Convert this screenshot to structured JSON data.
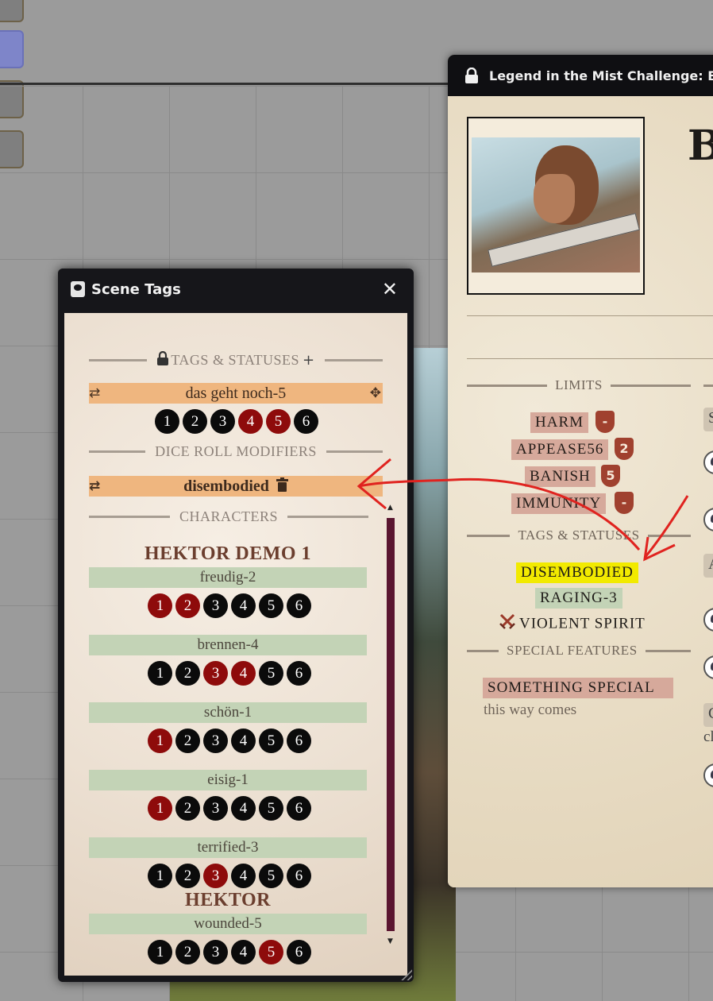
{
  "challenge_window": {
    "title": "Legend in the Mist Challenge: BAC",
    "name_visible": "B",
    "limits_heading": "LIMITS",
    "limits": [
      {
        "label": "HARM",
        "badge": "-"
      },
      {
        "label": "APPEASE56",
        "badge": "2"
      },
      {
        "label": "BANISH",
        "badge": "5"
      },
      {
        "label": "IMMUNITY",
        "badge": "-"
      }
    ],
    "tags_heading": "TAGS & STATUSES",
    "tags": [
      {
        "label": "DISEMBODIED",
        "color": "#f2ea00"
      },
      {
        "label": "RAGING-3",
        "color": "#c3d3b6"
      },
      {
        "label": "VIOLENT SPIRIT",
        "icon": "crossed-swords-icon"
      }
    ],
    "special_heading": "SPECIAL FEATURES",
    "special": {
      "label": "SOMETHING SPECIAL",
      "description": "this way comes"
    },
    "right_column_initials": [
      "S",
      "A",
      "C"
    ],
    "right_column_text": "cl"
  },
  "scene_tags": {
    "title": "Scene Tags",
    "close_label": "✕",
    "tags_heading": "TAGS & STATUSES",
    "tags_lock_icon": "lock-icon",
    "tags_add_icon": "plus-icon",
    "scene_tag": {
      "label": "das geht noch-5",
      "dice": [
        {
          "n": "1",
          "red": false
        },
        {
          "n": "2",
          "red": false
        },
        {
          "n": "3",
          "red": false
        },
        {
          "n": "4",
          "red": true
        },
        {
          "n": "5",
          "red": true
        },
        {
          "n": "6",
          "red": false
        }
      ]
    },
    "modifiers_heading": "DICE ROLL MODIFIERS",
    "modifier_tag": {
      "label": "disembodied",
      "delete_icon": "trash-icon"
    },
    "characters_heading": "CHARACTERS",
    "characters": [
      {
        "name": "HEKTOR DEMO 1",
        "statuses": [
          {
            "label": "freudig-2",
            "dice": [
              true,
              true,
              false,
              false,
              false,
              false
            ]
          },
          {
            "label": "brennen-4",
            "dice": [
              false,
              false,
              true,
              true,
              false,
              false
            ]
          },
          {
            "label": "schön-1",
            "dice": [
              true,
              false,
              false,
              false,
              false,
              false
            ]
          },
          {
            "label": "eisig-1",
            "dice": [
              true,
              false,
              false,
              false,
              false,
              false
            ]
          },
          {
            "label": "terrified-3",
            "dice": [
              false,
              false,
              true,
              false,
              false,
              false
            ]
          }
        ]
      },
      {
        "name": "HEKTOR",
        "statuses": [
          {
            "label": "wounded-5",
            "dice": [
              false,
              false,
              false,
              false,
              true,
              false
            ]
          }
        ]
      }
    ]
  },
  "colors": {
    "tag_orange": "#efb67f",
    "status_green": "#c3d3b6",
    "die_black": "#0b0b0b",
    "die_red": "#8e0b0b",
    "annotation_red": "#e0231f"
  }
}
